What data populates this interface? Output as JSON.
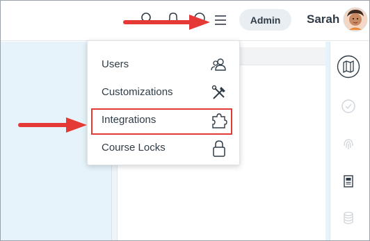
{
  "header": {
    "admin_label": "Admin",
    "user_name": "Sarah"
  },
  "icons": {
    "search": "search-icon",
    "notifications": "bell-icon",
    "help": "help-icon",
    "menu": "hamburger-menu-icon",
    "avatar": "user-avatar",
    "rail": [
      "map-icon",
      "check-circle-icon",
      "fingerprint-icon",
      "document-icon",
      "database-icon"
    ]
  },
  "menu": {
    "items": [
      {
        "label": "Users",
        "icon": "users-icon"
      },
      {
        "label": "Customizations",
        "icon": "tools-icon"
      },
      {
        "label": "Integrations",
        "icon": "puzzle-icon",
        "highlighted": true
      },
      {
        "label": "Course Locks",
        "icon": "lock-icon"
      }
    ]
  },
  "colors": {
    "annotation": "#e53935",
    "left_pane": "#e6f3fa",
    "text": "#2f3b46",
    "icon": "#2f3b46"
  }
}
